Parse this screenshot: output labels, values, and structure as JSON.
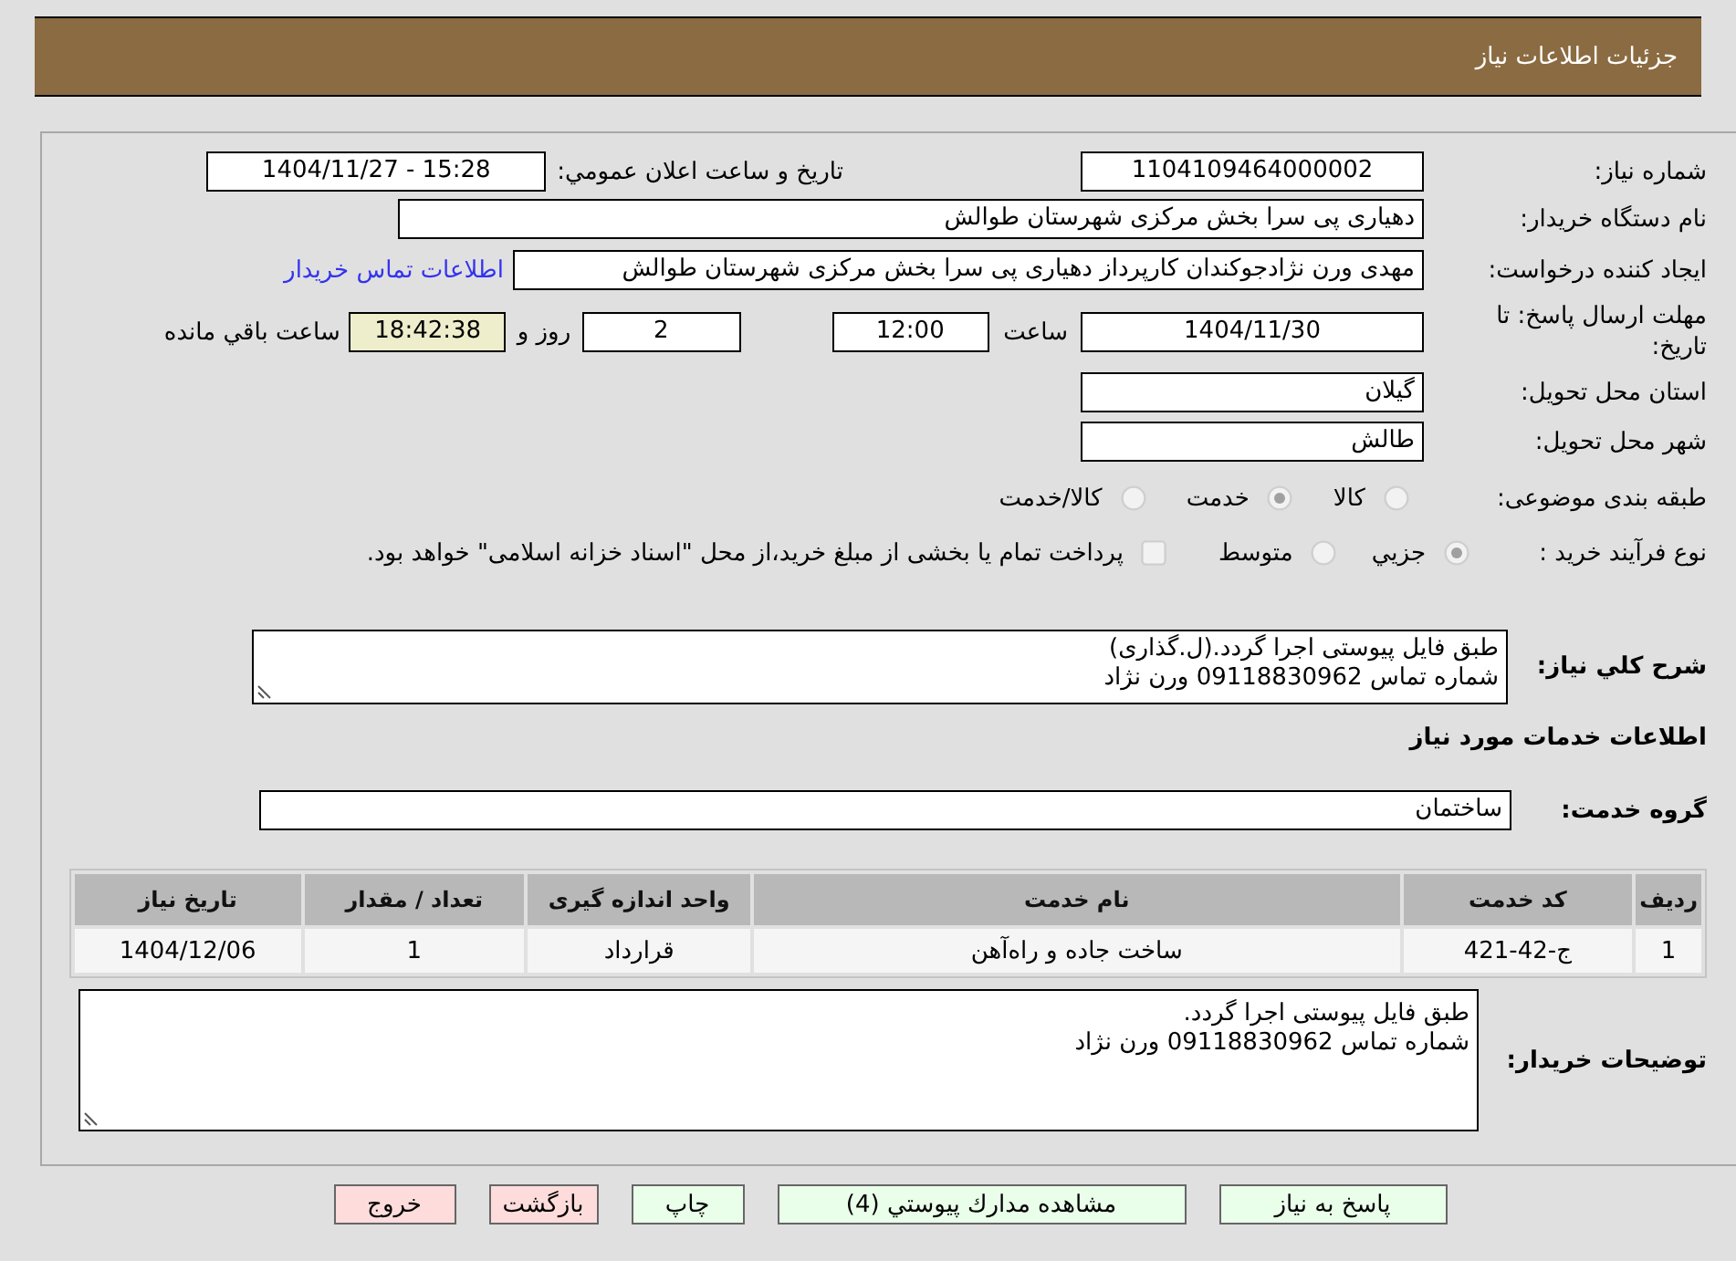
{
  "header": {
    "title": "جزئیات اطلاعات نیاز"
  },
  "need_number": {
    "label": "شماره نياز:",
    "value": "1104109464000002"
  },
  "announce": {
    "label": "تاريخ و ساعت اعلان عمومي:",
    "value": "1404/11/27 - 15:28"
  },
  "buyer_org": {
    "label": "نام دستگاه خريدار:",
    "value": "دهیاری پی سرا بخش مرکزی شهرستان طوالش"
  },
  "requester": {
    "label": "ايجاد كننده درخواست:",
    "value": "مهدی ورن نژادجوکندان کارپرداز دهیاری پی سرا بخش مرکزی شهرستان طوالش",
    "contact_link": "اطلاعات تماس خريدار"
  },
  "deadline": {
    "label": "مهلت ارسال پاسخ: تا تاريخ:",
    "date": "1404/11/30",
    "time_label": "ساعت",
    "time": "12:00",
    "days": "2",
    "days_label": "روز و",
    "remaining": "18:42:38",
    "remaining_label": "ساعت باقي مانده"
  },
  "province": {
    "label": "استان محل تحويل:",
    "value": "گيلان"
  },
  "city": {
    "label": "شهر محل تحويل:",
    "value": "طالش"
  },
  "category": {
    "label": "طبقه بندی موضوعی:",
    "options": [
      {
        "label": "کالا",
        "selected": false,
        "disabled": true
      },
      {
        "label": "خدمت",
        "selected": true,
        "disabled": true
      },
      {
        "label": "کالا/خدمت",
        "selected": false,
        "disabled": true
      }
    ]
  },
  "purchase_type": {
    "label": "نوع فرآيند خريد :",
    "options": [
      {
        "label": "جزيي",
        "selected": true,
        "disabled": true
      },
      {
        "label": "متوسط",
        "selected": false,
        "disabled": true
      }
    ],
    "treasury": {
      "label": "پرداخت تمام یا بخشی از مبلغ خرید،از محل \"اسناد خزانه اسلامی\" خواهد بود.",
      "checked": false,
      "disabled": true
    }
  },
  "description": {
    "label": "شرح کلي نياز:",
    "lines": [
      "طبق فایل پیوستی اجرا گردد.(ل.گذاری)",
      "شماره تماس 09118830962 ورن نژاد"
    ]
  },
  "services_title": "اطلاعات خدمات مورد نياز",
  "service_group": {
    "label": "گروه خدمت:",
    "value": "ساختمان"
  },
  "table": {
    "columns": [
      "رديف",
      "کد خدمت",
      "نام خدمت",
      "واحد اندازه گيری",
      "تعداد / مقدار",
      "تاريخ نياز"
    ],
    "rows": [
      [
        "1",
        "ج-42-421",
        "ساخت جاده و راه‌آهن",
        "قرارداد",
        "1",
        "1404/12/06"
      ]
    ]
  },
  "buyer_notes": {
    "label": "توضيحات خريدار:",
    "lines": [
      "طبق فایل پیوستی اجرا گردد.",
      "شماره تماس 09118830962 ورن نژاد"
    ]
  },
  "buttons": [
    {
      "label": "پاسخ به نياز",
      "kind": "action"
    },
    {
      "label": "مشاهده مدارك پيوستي (4)",
      "kind": "action"
    },
    {
      "label": "چاپ",
      "kind": "action"
    },
    {
      "label": "بازگشت",
      "kind": "exit"
    },
    {
      "label": "خروج",
      "kind": "exit"
    }
  ]
}
